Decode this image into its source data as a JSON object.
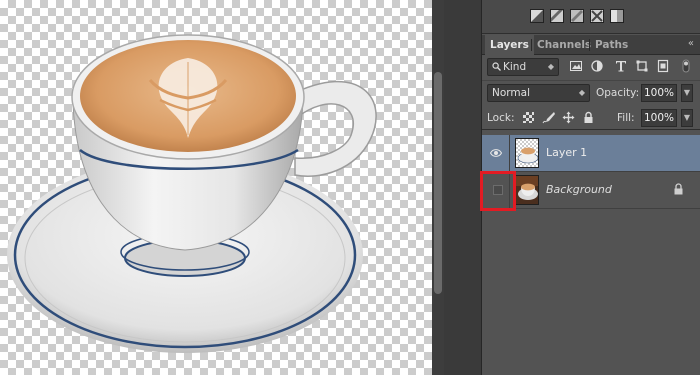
{
  "panel": {
    "tabs": [
      {
        "label": "Layers",
        "active": true
      },
      {
        "label": "Channels",
        "active": false
      },
      {
        "label": "Paths",
        "active": false
      }
    ],
    "collapse_glyph": "«",
    "filter": {
      "kind_label": "Kind",
      "kind_icon": "search-icon"
    },
    "blend": {
      "mode": "Normal",
      "opacity_label": "Opacity:",
      "opacity_value": "100%"
    },
    "lock": {
      "lock_label": "Lock:",
      "fill_label": "Fill:",
      "fill_value": "100%"
    },
    "layers": [
      {
        "name": "Layer 1",
        "visible": true,
        "selected": true,
        "italic": false,
        "locked": false
      },
      {
        "name": "Background",
        "visible": false,
        "selected": false,
        "italic": true,
        "locked": true
      }
    ]
  },
  "colors": {
    "selection": "#6b7f99",
    "highlight": "#e31b23",
    "panel_bg": "#535353"
  }
}
